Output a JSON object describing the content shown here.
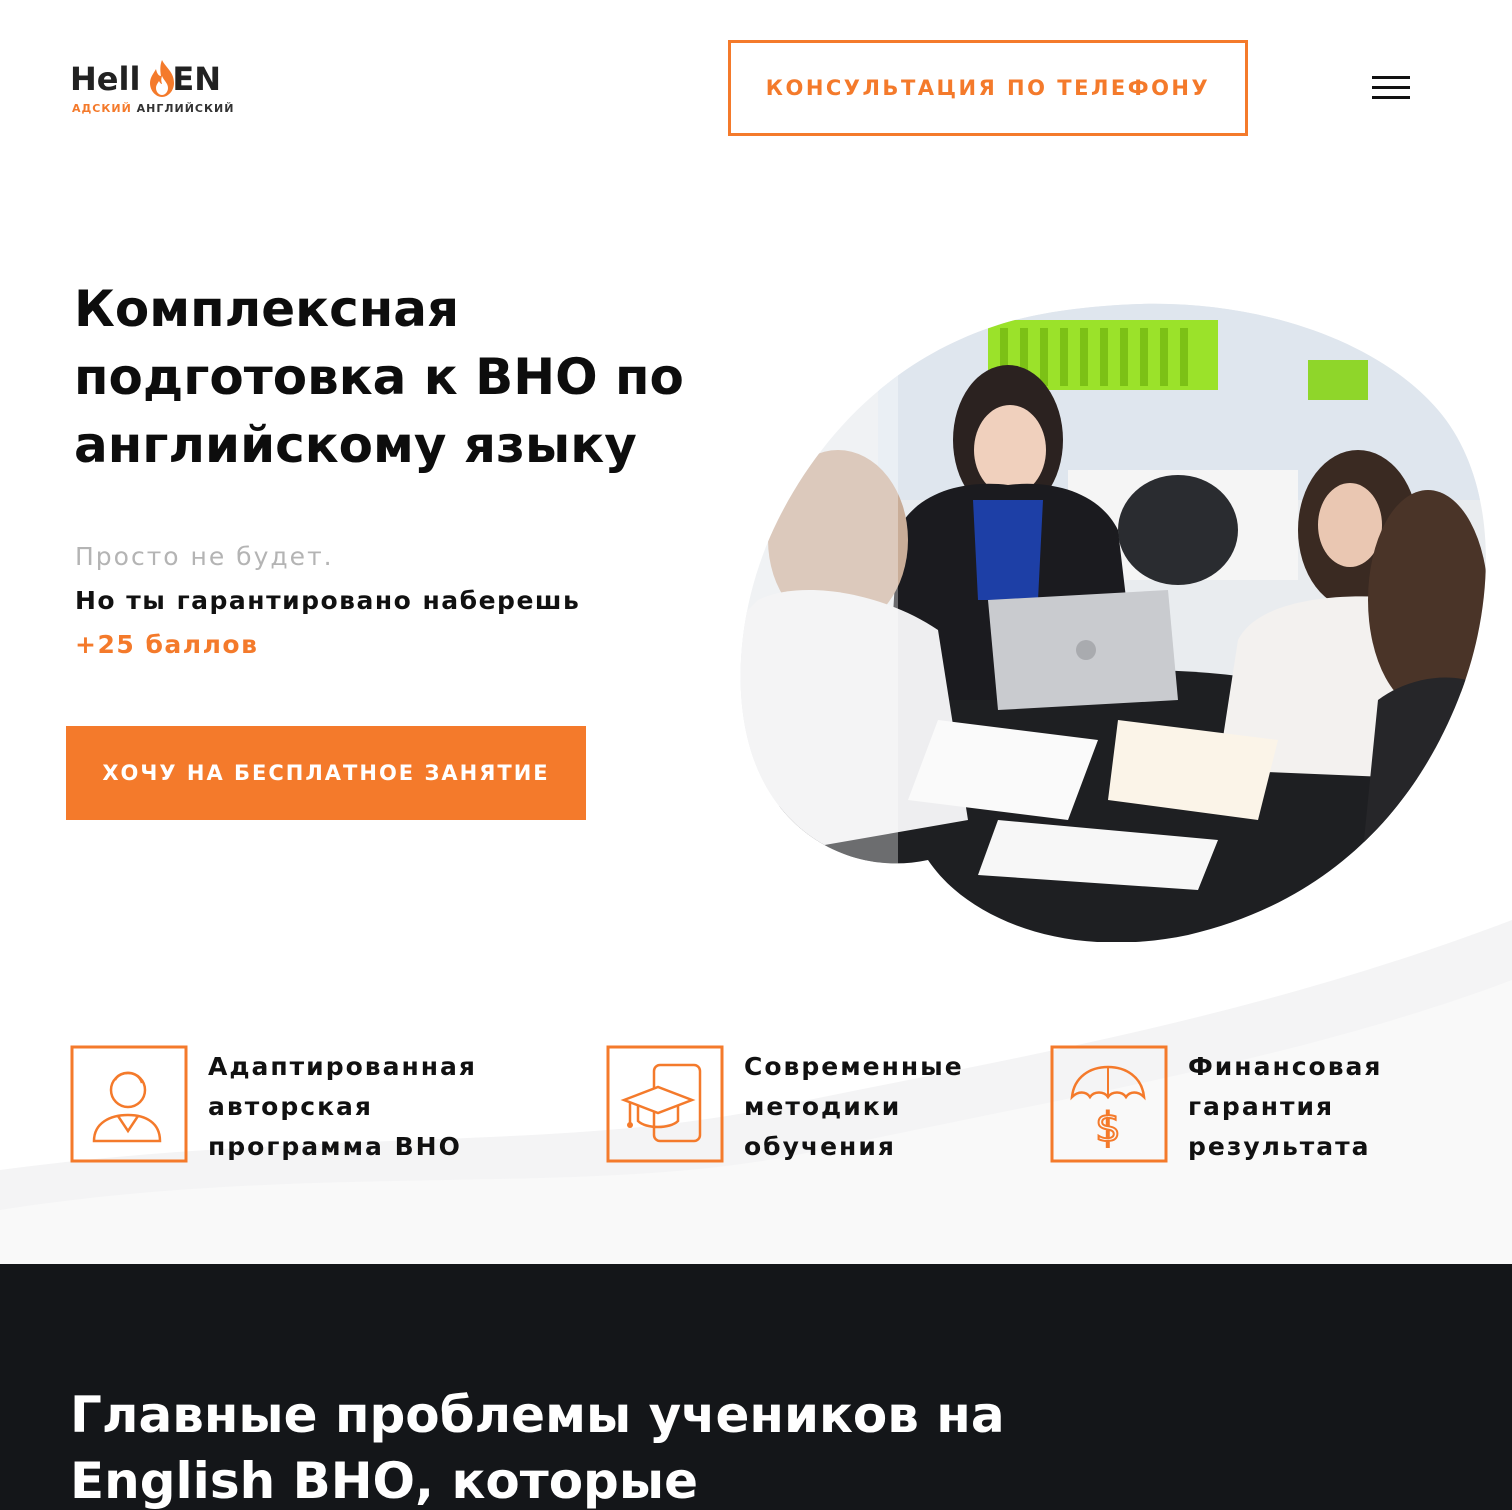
{
  "header": {
    "logo_part1": "Hell",
    "logo_part2": "EN",
    "logo_tag_orange": "АДСКИЙ",
    "logo_tag_dark": "АНГЛИЙСКИЙ",
    "phone_button": "КОНСУЛЬТАЦИЯ ПО ТЕЛЕФОНУ"
  },
  "hero": {
    "title": "Комплексная подготовка к ВНО по английскому языку",
    "sub1": "Просто не будет.",
    "sub2": "Но ты гарантировано наберешь",
    "sub3": "+25 баллов",
    "cta": "ХОЧУ НА БЕСПЛАТНОЕ ЗАНЯТИЕ"
  },
  "features": [
    {
      "line1": "Адаптированная",
      "line2": "авторская",
      "line3": "программа ВНО",
      "icon": "person-icon"
    },
    {
      "line1": "Современные",
      "line2": "методики",
      "line3": "обучения",
      "icon": "graduation-phone-icon"
    },
    {
      "line1": "Финансовая",
      "line2": "гарантия",
      "line3": "результата",
      "icon": "umbrella-dollar-icon"
    }
  ],
  "problems": {
    "title": "Главные проблемы учеников на English ВНО, которые"
  },
  "colors": {
    "accent": "#f47a2b",
    "dark": "#141619"
  }
}
